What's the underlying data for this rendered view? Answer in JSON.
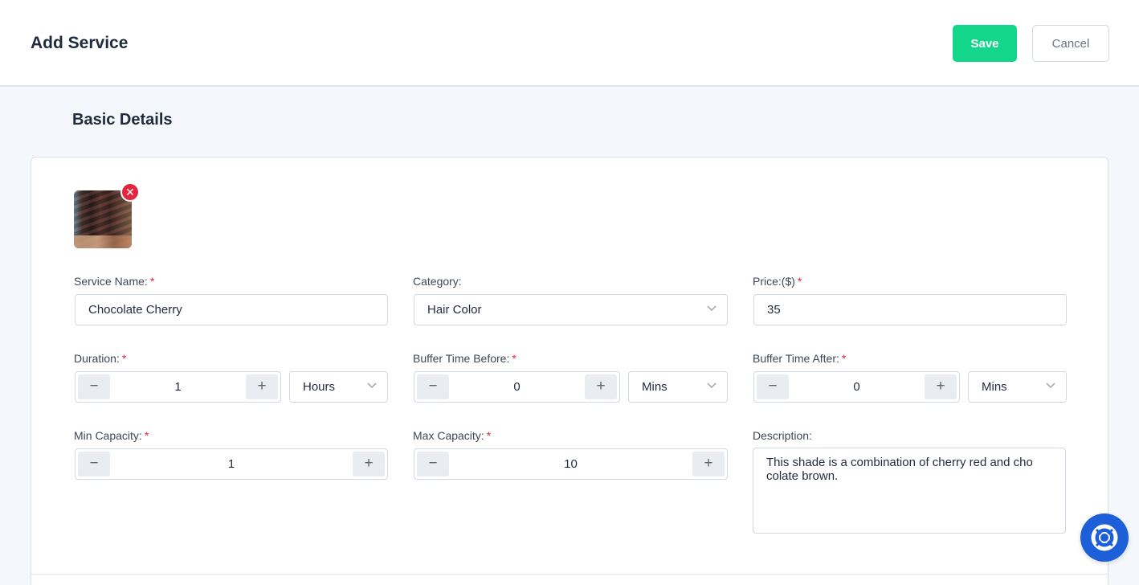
{
  "header": {
    "title": "Add Service",
    "save_label": "Save",
    "cancel_label": "Cancel"
  },
  "section": {
    "title": "Basic Details"
  },
  "image": {
    "remove_icon": "close-icon"
  },
  "fields": {
    "service_name": {
      "label": "Service Name:",
      "required": "*",
      "value": "Chocolate Cherry"
    },
    "category": {
      "label": "Category:",
      "value": "Hair Color"
    },
    "price": {
      "label": "Price:($)",
      "required": "*",
      "value": "35"
    },
    "duration": {
      "label": "Duration:",
      "required": "*",
      "value": "1",
      "unit": "Hours"
    },
    "buffer_before": {
      "label": "Buffer Time Before:",
      "required": "*",
      "value": "0",
      "unit": "Mins"
    },
    "buffer_after": {
      "label": "Buffer Time After:",
      "required": "*",
      "value": "0",
      "unit": "Mins"
    },
    "min_capacity": {
      "label": "Min Capacity:",
      "required": "*",
      "value": "1"
    },
    "max_capacity": {
      "label": "Max Capacity:",
      "required": "*",
      "value": "10"
    },
    "description": {
      "label": "Description:",
      "value": "This shade is a combination of cherry red and cho colate brown."
    }
  },
  "stepper": {
    "minus": "−",
    "plus": "+"
  },
  "colors": {
    "accent": "#13d68b",
    "required": "#e5243f",
    "help": "#1d5fd9"
  }
}
